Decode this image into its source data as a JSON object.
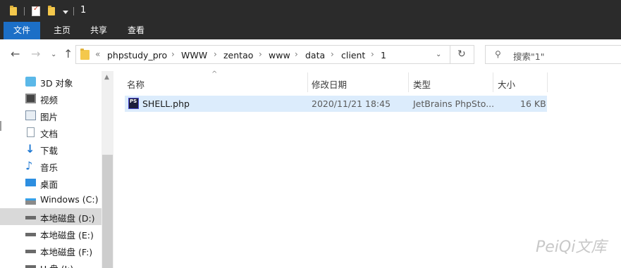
{
  "window": {
    "title": "1"
  },
  "ribbon": {
    "tabs": [
      {
        "label": "文件",
        "active": true
      },
      {
        "label": "主页"
      },
      {
        "label": "共享"
      },
      {
        "label": "查看"
      }
    ]
  },
  "address": {
    "overflow": "«",
    "crumbs": [
      "phpstudy_pro",
      "WWW",
      "zentao",
      "www",
      "data",
      "client",
      "1"
    ],
    "separator": "›"
  },
  "search": {
    "placeholder": "搜索\"1\""
  },
  "nav": {
    "items": [
      {
        "label": "3D 对象",
        "icon": "cube-3d-icon"
      },
      {
        "label": "视频",
        "icon": "video-icon"
      },
      {
        "label": "图片",
        "icon": "pictures-icon"
      },
      {
        "label": "文档",
        "icon": "documents-icon"
      },
      {
        "label": "下载",
        "icon": "download-arrow-icon"
      },
      {
        "label": "音乐",
        "icon": "music-note-icon"
      },
      {
        "label": "桌面",
        "icon": "desktop-icon"
      },
      {
        "label": "Windows (C:)",
        "icon": "windows-drive-icon"
      },
      {
        "label": "本地磁盘 (D:)",
        "icon": "hard-drive-icon",
        "selected": true
      },
      {
        "label": "本地磁盘 (E:)",
        "icon": "hard-drive-icon"
      },
      {
        "label": "本地磁盘 (F:)",
        "icon": "hard-drive-icon"
      },
      {
        "label": "U 盘 (I:)",
        "icon": "usb-drive-icon"
      }
    ]
  },
  "columns": {
    "name": "名称",
    "modified": "修改日期",
    "type": "类型",
    "size": "大小"
  },
  "files": [
    {
      "icon": "phpstorm-file-icon",
      "name": "SHELL.php",
      "modified": "2020/11/21 18:45",
      "type": "JetBrains PhpSto...",
      "size": "16 KB"
    }
  ],
  "watermark": "PeiQi文库",
  "colors": {
    "titlebar": "#2b2b2b",
    "file_tab": "#1c6fc7",
    "row_highlight": "#dcecfc",
    "nav_selected": "#d9d9d9"
  }
}
